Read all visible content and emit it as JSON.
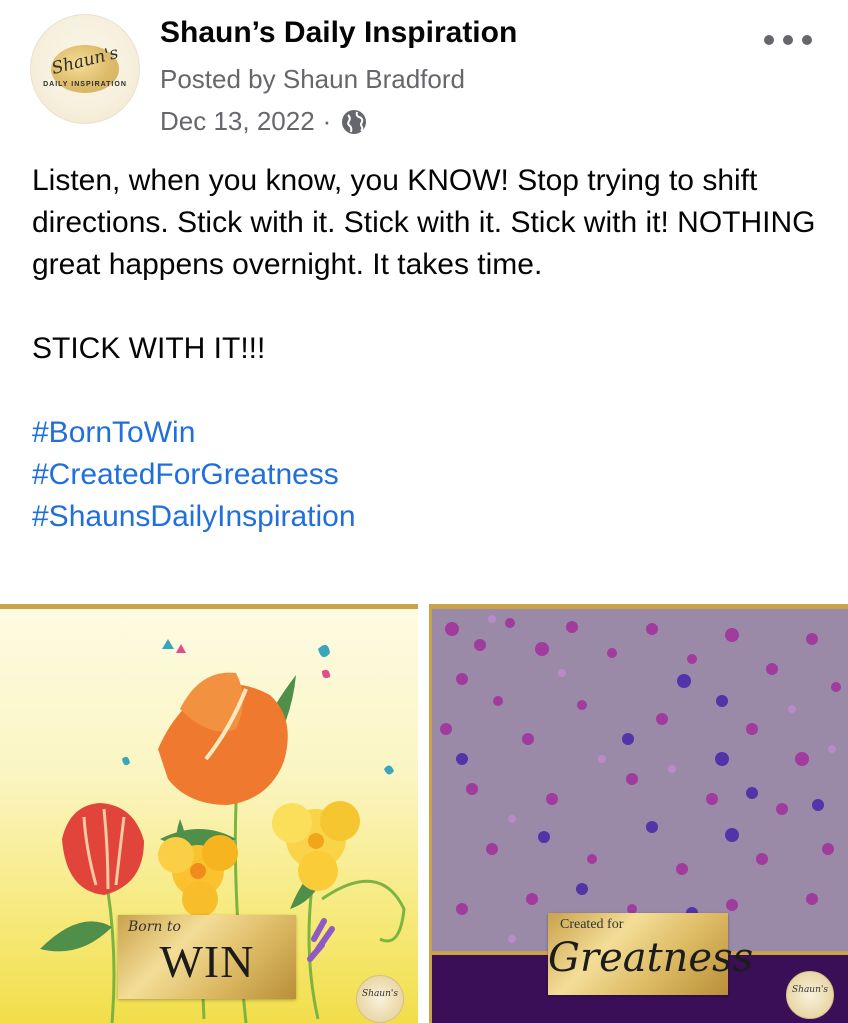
{
  "header": {
    "page_name": "Shaun’s Daily Inspiration",
    "posted_by": "Posted by Shaun Bradford",
    "date": "Dec 13, 2022",
    "separator": "·",
    "privacy_icon": "globe-icon",
    "avatar": {
      "script": "Shaun's",
      "subtitle": "DAILY INSPIRATION"
    }
  },
  "post": {
    "paragraph1": "Listen, when you know, you KNOW! Stop trying to shift directions. Stick with it. Stick with it. Stick with it! NOTHING great happens overnight. It takes time.",
    "paragraph2": "STICK WITH IT!!!",
    "hashtags": [
      "#BornToWin",
      "#CreatedForGreatness",
      "#ShaunsDailyInspiration"
    ]
  },
  "photos": {
    "left": {
      "caption_small": "Born to",
      "caption_big": "WIN",
      "seal": "Shaun's"
    },
    "right": {
      "caption_small": "Created for",
      "caption_big": "Greatness",
      "seal": "Shaun's"
    }
  },
  "colors": {
    "hashtag": "#216fdb",
    "meta": "#65676b",
    "gold": "#c9a24b",
    "purple": "#3a0f57"
  }
}
